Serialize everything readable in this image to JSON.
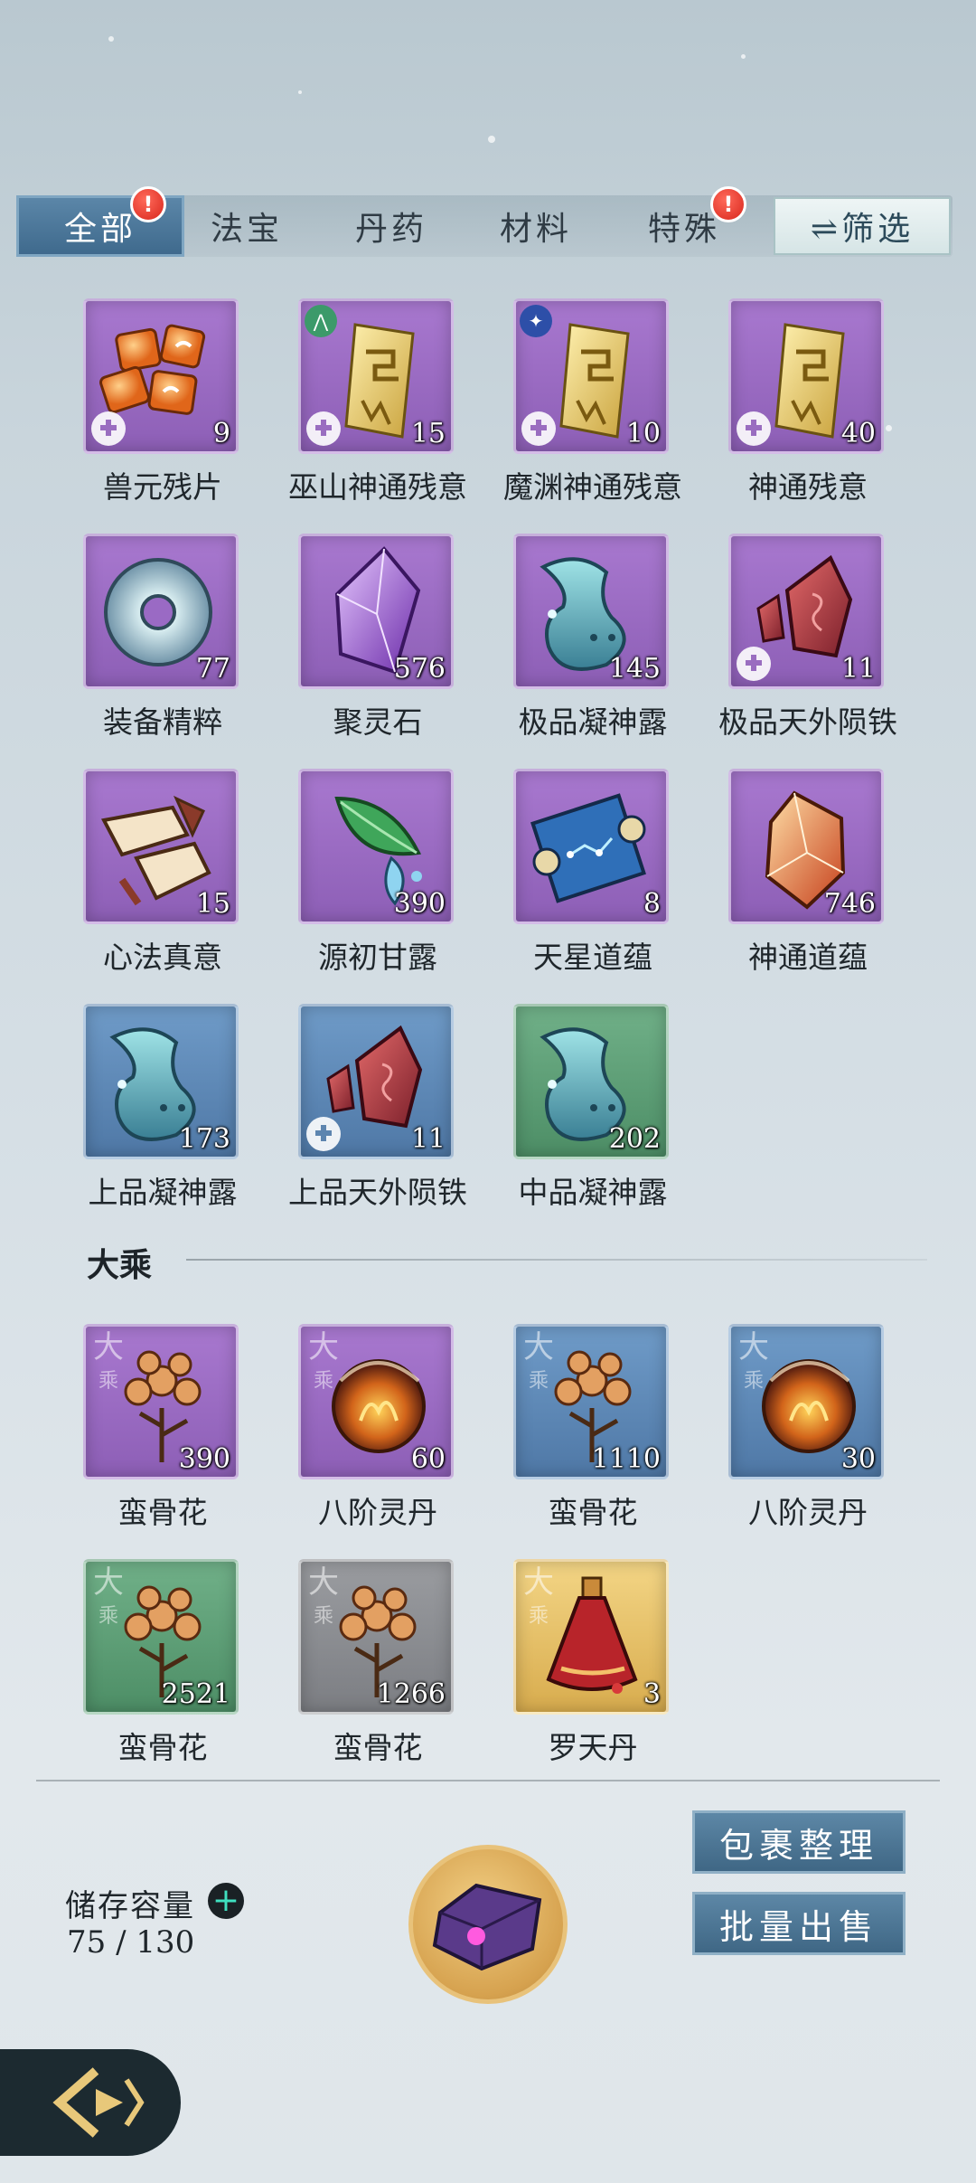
{
  "tabs": [
    {
      "label": "全部",
      "active": true,
      "has_alert": true
    },
    {
      "label": "法宝",
      "active": false,
      "has_alert": false
    },
    {
      "label": "丹药",
      "active": false,
      "has_alert": false
    },
    {
      "label": "材料",
      "active": false,
      "has_alert": false
    },
    {
      "label": "特殊",
      "active": false,
      "has_alert": true
    }
  ],
  "alert_mark": "!",
  "filter": {
    "icon": "swap-arrows-icon",
    "label": "⇌筛选"
  },
  "items": [
    {
      "name": "兽元残片",
      "count": "9",
      "rarity": "purple",
      "icon": "beast-shards-icon",
      "fragment": true
    },
    {
      "name": "巫山神通残意",
      "count": "15",
      "rarity": "purple",
      "icon": "golden-scroll-icon",
      "fragment": true,
      "faction": "green-faction-icon"
    },
    {
      "name": "魔渊神通残意",
      "count": "10",
      "rarity": "purple",
      "icon": "golden-scroll-icon",
      "fragment": true,
      "faction": "blue-faction-icon"
    },
    {
      "name": "神通残意",
      "count": "40",
      "rarity": "purple",
      "icon": "golden-scroll-icon",
      "fragment": true
    },
    {
      "name": "装备精粹",
      "count": "77",
      "rarity": "purple",
      "icon": "jade-ring-icon"
    },
    {
      "name": "聚灵石",
      "count": "576",
      "rarity": "purple",
      "icon": "violet-crystal-icon"
    },
    {
      "name": "极品凝神露",
      "count": "145",
      "rarity": "purple",
      "icon": "dew-gourd-icon"
    },
    {
      "name": "极品天外陨铁",
      "count": "11",
      "rarity": "purple",
      "icon": "red-ore-icon",
      "fragment": true
    },
    {
      "name": "心法真意",
      "count": "15",
      "rarity": "purple",
      "icon": "broken-scroll-icon"
    },
    {
      "name": "源初甘露",
      "count": "390",
      "rarity": "purple",
      "icon": "leaf-dew-icon"
    },
    {
      "name": "天星道蕴",
      "count": "8",
      "rarity": "purple",
      "icon": "star-scroll-icon"
    },
    {
      "name": "神通道蕴",
      "count": "746",
      "rarity": "purple",
      "icon": "amber-crystal-icon"
    },
    {
      "name": "上品凝神露",
      "count": "173",
      "rarity": "blue",
      "icon": "dew-gourd-icon"
    },
    {
      "name": "上品天外陨铁",
      "count": "11",
      "rarity": "blue",
      "icon": "red-ore-icon",
      "fragment": true
    },
    {
      "name": "中品凝神露",
      "count": "202",
      "rarity": "green",
      "icon": "dew-gourd-icon"
    }
  ],
  "section": {
    "title": "大乘"
  },
  "tier_mark": "大",
  "tier_mark_sub": "乘",
  "items_section": [
    {
      "name": "蛮骨花",
      "count": "390",
      "rarity": "purple",
      "icon": "bone-flower-icon"
    },
    {
      "name": "八阶灵丹",
      "count": "60",
      "rarity": "purple",
      "icon": "fire-pill-icon"
    },
    {
      "name": "蛮骨花",
      "count": "1110",
      "rarity": "blue",
      "icon": "bone-flower-icon"
    },
    {
      "name": "八阶灵丹",
      "count": "30",
      "rarity": "blue",
      "icon": "fire-pill-icon"
    },
    {
      "name": "蛮骨花",
      "count": "2521",
      "rarity": "green",
      "icon": "bone-flower-icon"
    },
    {
      "name": "蛮骨花",
      "count": "1266",
      "rarity": "gray",
      "icon": "bone-flower-icon"
    },
    {
      "name": "罗天丹",
      "count": "3",
      "rarity": "gold",
      "icon": "red-elixir-bottle-icon"
    }
  ],
  "storage": {
    "label": "储存容量",
    "value": "75 / 130",
    "plus": "+"
  },
  "buttons": {
    "organize": "包裹整理",
    "bulk_sell": "批量出售"
  },
  "bag_icon": "purple-bag-icon",
  "back_icon": "back-arrow-icon"
}
